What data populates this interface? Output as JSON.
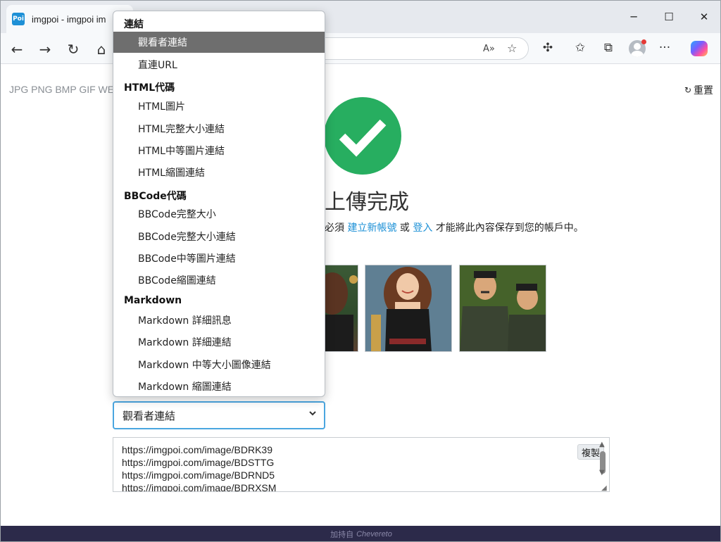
{
  "browser": {
    "tab_title": "imgpoi - imgpoi im",
    "favicon_text": "Poi",
    "window_controls": {
      "minimize": "─",
      "maximize": "☐",
      "close": "✕"
    },
    "nav": {
      "back": "←",
      "forward": "→",
      "reload": "↻",
      "home": "⌂"
    },
    "toolbar_icons": {
      "read_aloud": "A»",
      "favorite": "☆",
      "extensions": "✣",
      "favorites": "✩",
      "screenshot": "⧉",
      "menu": "···"
    }
  },
  "page": {
    "formats": "JPG PNG BMP GIF WE",
    "reset_icon": "↻",
    "reset_label": "重置",
    "check_mark": "✔",
    "heading": "上傳完成",
    "info": {
      "prefix": "必須",
      "create_account": "建立新帳號",
      "or": "或",
      "login": "登入",
      "suffix": "才能將此內容保存到您的帳戶中。"
    },
    "select_value": "觀看者連結",
    "select_chevron": "⌄",
    "urls": [
      "https://imgpoi.com/image/BDRK39",
      "https://imgpoi.com/image/BDSTTG",
      "https://imgpoi.com/image/BDRND5",
      "https://imgpoi.com/image/BDRXSM"
    ],
    "copy_label": "複製",
    "footer": {
      "prefix": "加持自",
      "brand": "Chevereto"
    }
  },
  "dropdown": {
    "groups": [
      {
        "label": "連結",
        "options": [
          "觀看者連結",
          "直連URL"
        ]
      },
      {
        "label": "HTML代碼",
        "options": [
          "HTML圖片",
          "HTML完整大小連結",
          "HTML中等圖片連結",
          "HTML縮圖連結"
        ]
      },
      {
        "label": "BBCode代碼",
        "options": [
          "BBCode完整大小",
          "BBCode完整大小連結",
          "BBCode中等圖片連結",
          "BBCode縮圖連結"
        ]
      },
      {
        "label": "Markdown",
        "options": [
          "Markdown 詳細訊息",
          "Markdown 詳細連結",
          "Markdown 中等大小圖像連結",
          "Markdown 縮圖連結"
        ]
      }
    ],
    "selected": "觀看者連結"
  },
  "colors": {
    "accent_link": "#1a8fd6",
    "success_green": "#27ae60",
    "selected_option_bg": "#6e6e6e",
    "footer_bg": "#2c2a4a",
    "select_border": "#4aa6e0"
  }
}
